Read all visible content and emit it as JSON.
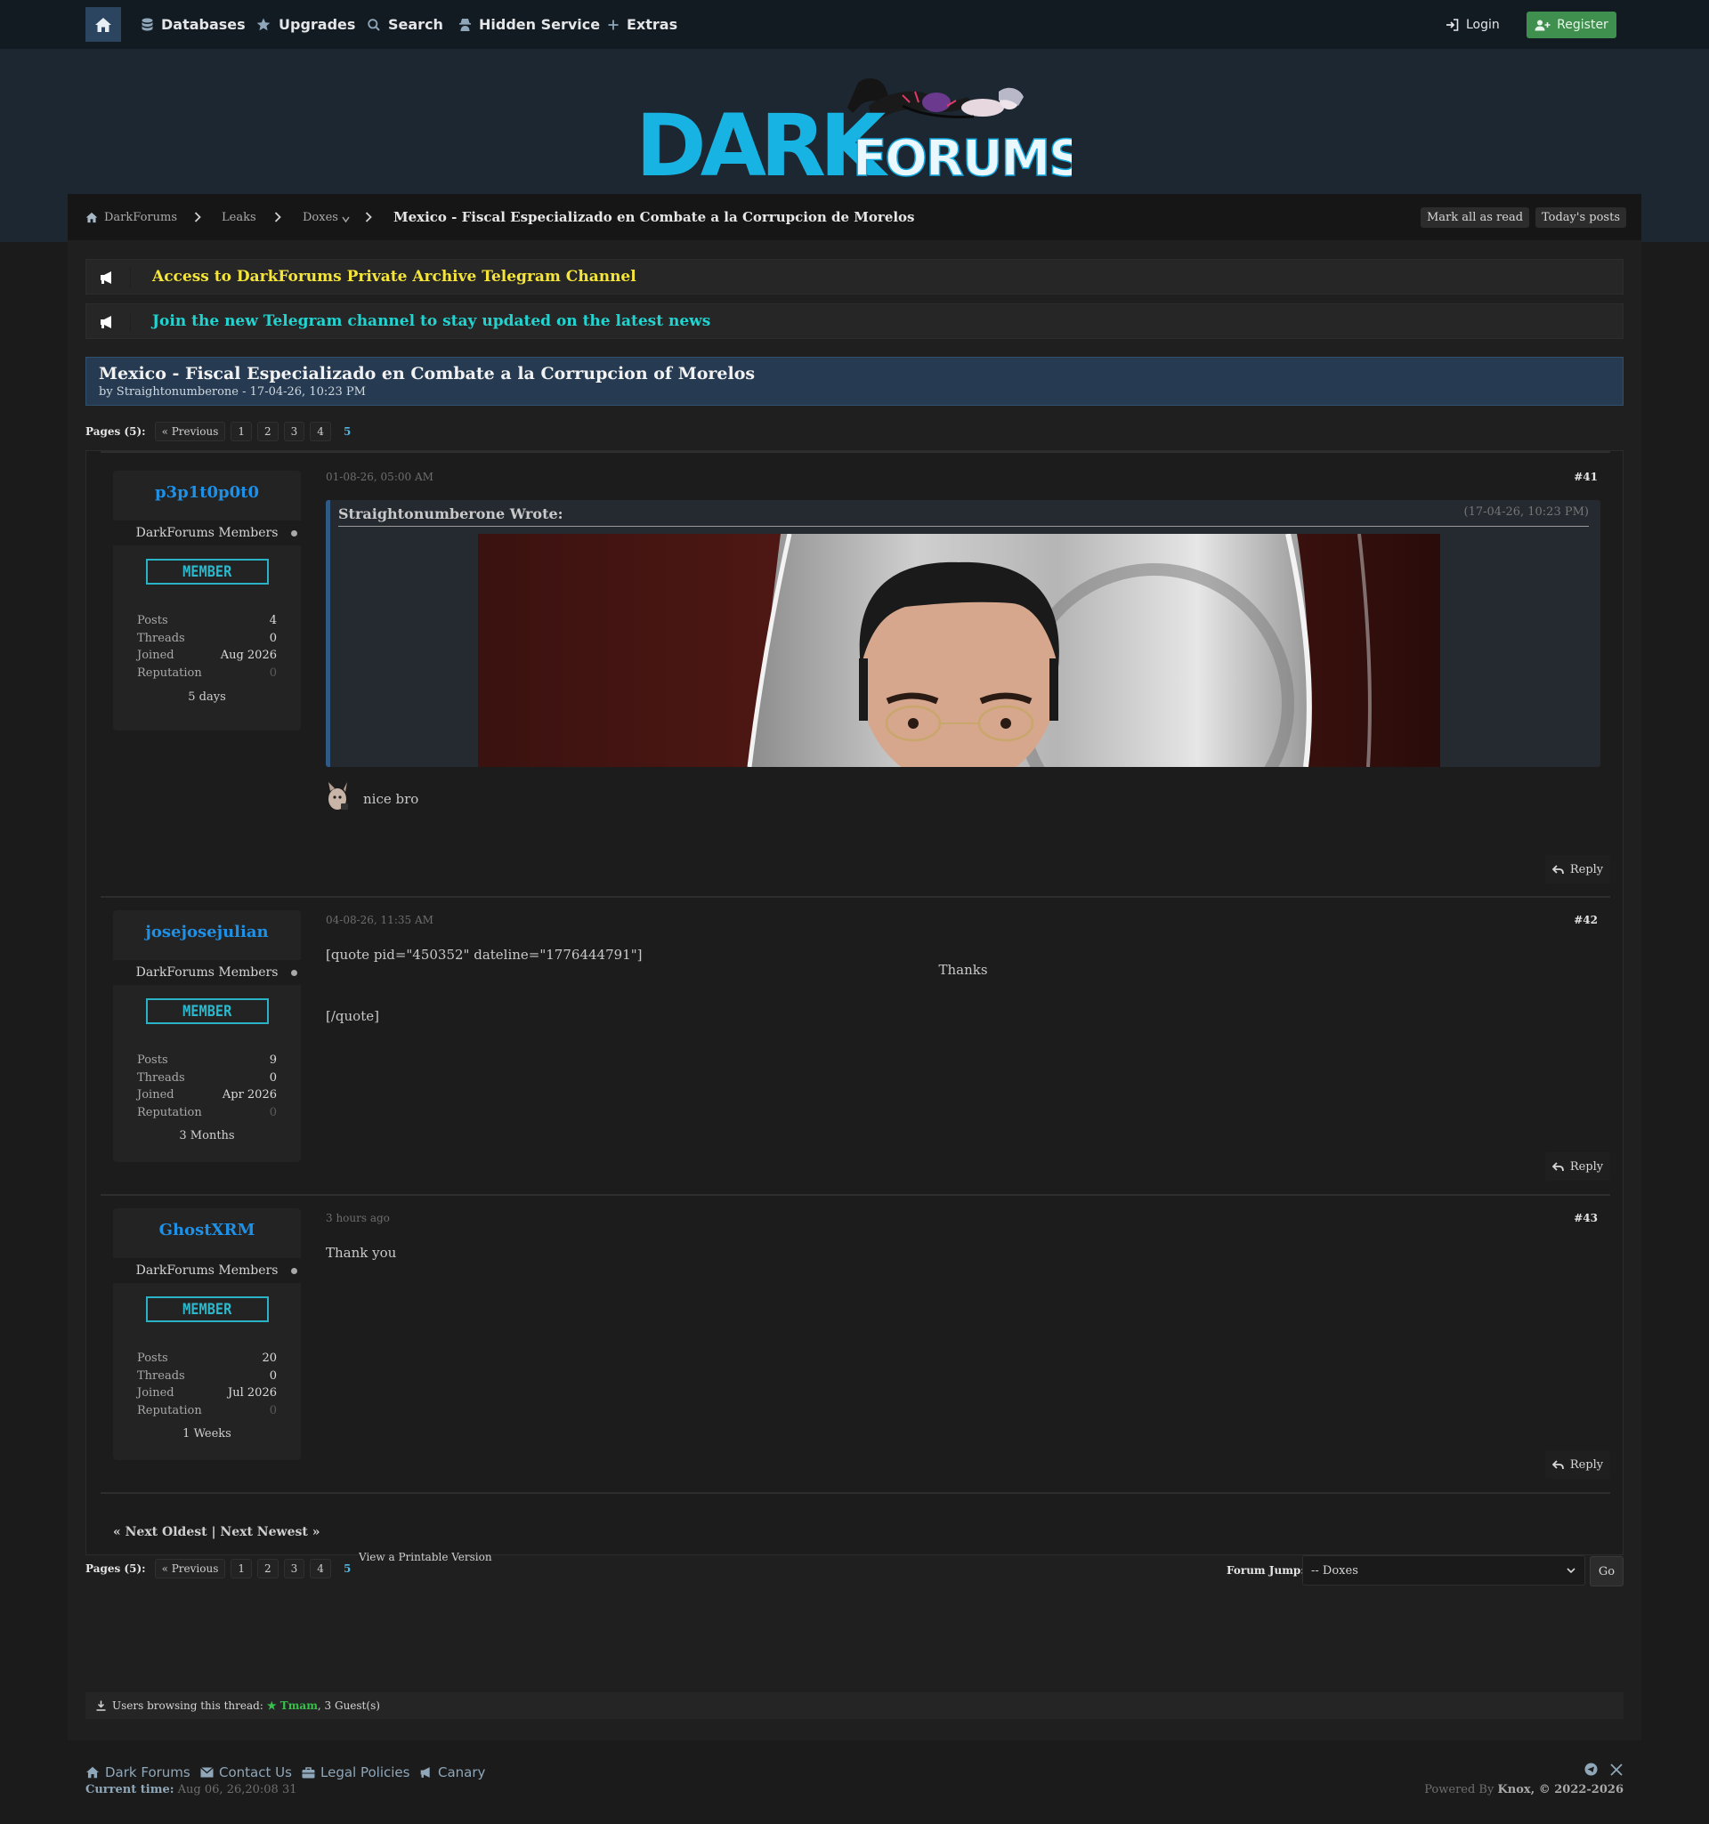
{
  "nav": {
    "items": [
      {
        "label": "Databases",
        "icon": "database-icon"
      },
      {
        "label": "Upgrades",
        "icon": "star-icon"
      },
      {
        "label": "Search",
        "icon": "search-icon"
      },
      {
        "label": "Hidden Service",
        "icon": "spy-icon"
      },
      {
        "label": "Extras",
        "icon": "plus-icon"
      }
    ],
    "login": "Login",
    "register": "Register"
  },
  "logo": {
    "dark": "DARK",
    "forums": "FORUMS"
  },
  "breadcrumb": {
    "home": "DarkForums",
    "leaks": "Leaks",
    "doxes": "Doxes",
    "current": "Mexico - Fiscal Especializado en Combate a la Corrupcion de Morelos",
    "mark_read": "Mark all as read",
    "todays_posts": "Today's posts"
  },
  "announcements": [
    {
      "text": "Access to DarkForums Private Archive Telegram Channel",
      "color": "#f5e53a"
    },
    {
      "text": "Join the new Telegram channel to stay updated on the latest news",
      "color": "#22d3d0"
    }
  ],
  "thread": {
    "title": "Mexico - Fiscal Especializado en Combate a la Corrupcion of Morelos",
    "by": "by Straightonumberone - 17-04-26, 10:23 PM"
  },
  "pagination": {
    "label": "Pages (5):",
    "previous": "« Previous",
    "pages": [
      "1",
      "2",
      "3",
      "4"
    ],
    "current": "5"
  },
  "posts": [
    {
      "username": "p3p1t0p0t0",
      "group": "DarkForums Members",
      "badge": "MEMBER",
      "stats": {
        "posts": "4",
        "threads": "0",
        "joined": "Aug 2026",
        "reputation": "0"
      },
      "age": "5 days",
      "date": "01-08-26, 05:00 AM",
      "number": "#41",
      "quote": {
        "author": "Straightonumberone Wrote:",
        "date": "(17-04-26, 10:23 PM)"
      },
      "body": "nice bro"
    },
    {
      "username": "josejosejulian",
      "group": "DarkForums Members",
      "badge": "MEMBER",
      "stats": {
        "posts": "9",
        "threads": "0",
        "joined": "Apr 2026",
        "reputation": "0"
      },
      "age": "3 Months",
      "date": "04-08-26, 11:35 AM",
      "number": "#42",
      "body_line1": "[quote pid=\"450352\" dateline=\"1776444791\"]",
      "body_center": "Thanks",
      "body_line2": "[/quote]"
    },
    {
      "username": "GhostXRM",
      "group": "DarkForums Members",
      "badge": "MEMBER",
      "stats": {
        "posts": "20",
        "threads": "0",
        "joined": "Jul 2026",
        "reputation": "0"
      },
      "age": "1 Weeks",
      "date": "3 hours ago",
      "number": "#43",
      "body": "Thank you"
    }
  ],
  "labels": {
    "posts": "Posts",
    "threads": "Threads",
    "joined": "Joined",
    "reputation": "Reputation",
    "reply": "Reply"
  },
  "next_links": "« Next Oldest | Next Newest »",
  "printable": "View a Printable Version",
  "forum_jump": {
    "label": "Forum Jump:",
    "selected": "-- Doxes",
    "go": "Go"
  },
  "browsing": {
    "prefix": "Users browsing this thread:",
    "user": "Tmam",
    "suffix": ", 3 Guest(s)"
  },
  "footer": {
    "links": [
      "Dark Forums",
      "Contact Us",
      "Legal Policies",
      "Canary"
    ],
    "current_time_label": "Current time:",
    "current_time": "Aug 06, 26,20:08 31",
    "powered_prefix": "Powered By",
    "powered_by": "Knox",
    "copyright": ", © 2022-2026"
  }
}
